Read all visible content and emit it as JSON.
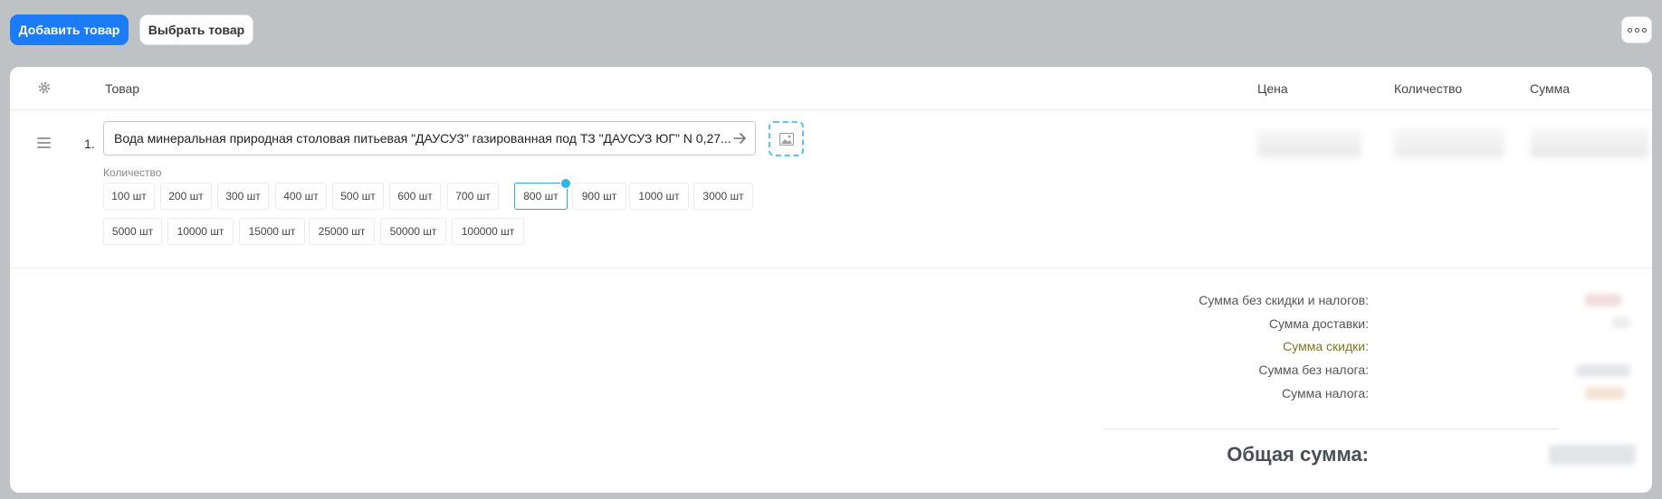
{
  "toolbar": {
    "add_label": "Добавить товар",
    "select_label": "Выбрать товар",
    "more_icon": "more-dots-icon"
  },
  "table": {
    "headers": {
      "settings_icon": "gear-icon",
      "product": "Товар",
      "price": "Цена",
      "quantity": "Количество",
      "sum": "Сумма"
    }
  },
  "row": {
    "number": "1.",
    "product_name": "Вода минеральная природная столовая питьевая \"ДАУСУЗ\" газированная под ТЗ \"ДАУСУЗ ЮГ\" N 0,27...",
    "quantity_label": "Количество",
    "quantity_options": [
      "100 шт",
      "200 шт",
      "300 шт",
      "400 шт",
      "500 шт",
      "600 шт",
      "700 шт",
      "800 шт",
      "900 шт",
      "1000 шт",
      "3000 шт",
      "5000 шт",
      "10000 шт",
      "15000 шт",
      "25000 шт",
      "50000 шт",
      "100000 шт"
    ],
    "selected_quantity": "800 шт"
  },
  "totals": {
    "subtotal_label": "Сумма без скидки и налогов:",
    "delivery_label": "Сумма доставки:",
    "discount_label": "Сумма скидки:",
    "pretax_label": "Сумма без налога:",
    "tax_label": "Сумма налога:",
    "grand_label": "Общая сумма:"
  },
  "colors": {
    "primary": "#1b7cf5",
    "accent": "#2fb4e6",
    "background": "#bec2c5"
  }
}
